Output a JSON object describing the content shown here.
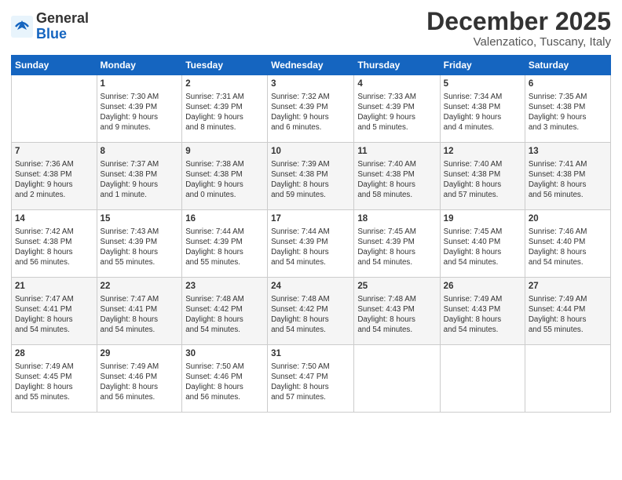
{
  "logo": {
    "general": "General",
    "blue": "Blue"
  },
  "header": {
    "month": "December 2025",
    "location": "Valenzatico, Tuscany, Italy"
  },
  "weekdays": [
    "Sunday",
    "Monday",
    "Tuesday",
    "Wednesday",
    "Thursday",
    "Friday",
    "Saturday"
  ],
  "weeks": [
    [
      {
        "day": null,
        "info": null
      },
      {
        "day": "1",
        "info": "Sunrise: 7:30 AM\nSunset: 4:39 PM\nDaylight: 9 hours\nand 9 minutes."
      },
      {
        "day": "2",
        "info": "Sunrise: 7:31 AM\nSunset: 4:39 PM\nDaylight: 9 hours\nand 8 minutes."
      },
      {
        "day": "3",
        "info": "Sunrise: 7:32 AM\nSunset: 4:39 PM\nDaylight: 9 hours\nand 6 minutes."
      },
      {
        "day": "4",
        "info": "Sunrise: 7:33 AM\nSunset: 4:39 PM\nDaylight: 9 hours\nand 5 minutes."
      },
      {
        "day": "5",
        "info": "Sunrise: 7:34 AM\nSunset: 4:38 PM\nDaylight: 9 hours\nand 4 minutes."
      },
      {
        "day": "6",
        "info": "Sunrise: 7:35 AM\nSunset: 4:38 PM\nDaylight: 9 hours\nand 3 minutes."
      }
    ],
    [
      {
        "day": "7",
        "info": "Sunrise: 7:36 AM\nSunset: 4:38 PM\nDaylight: 9 hours\nand 2 minutes."
      },
      {
        "day": "8",
        "info": "Sunrise: 7:37 AM\nSunset: 4:38 PM\nDaylight: 9 hours\nand 1 minute."
      },
      {
        "day": "9",
        "info": "Sunrise: 7:38 AM\nSunset: 4:38 PM\nDaylight: 9 hours\nand 0 minutes."
      },
      {
        "day": "10",
        "info": "Sunrise: 7:39 AM\nSunset: 4:38 PM\nDaylight: 8 hours\nand 59 minutes."
      },
      {
        "day": "11",
        "info": "Sunrise: 7:40 AM\nSunset: 4:38 PM\nDaylight: 8 hours\nand 58 minutes."
      },
      {
        "day": "12",
        "info": "Sunrise: 7:40 AM\nSunset: 4:38 PM\nDaylight: 8 hours\nand 57 minutes."
      },
      {
        "day": "13",
        "info": "Sunrise: 7:41 AM\nSunset: 4:38 PM\nDaylight: 8 hours\nand 56 minutes."
      }
    ],
    [
      {
        "day": "14",
        "info": "Sunrise: 7:42 AM\nSunset: 4:38 PM\nDaylight: 8 hours\nand 56 minutes."
      },
      {
        "day": "15",
        "info": "Sunrise: 7:43 AM\nSunset: 4:39 PM\nDaylight: 8 hours\nand 55 minutes."
      },
      {
        "day": "16",
        "info": "Sunrise: 7:44 AM\nSunset: 4:39 PM\nDaylight: 8 hours\nand 55 minutes."
      },
      {
        "day": "17",
        "info": "Sunrise: 7:44 AM\nSunset: 4:39 PM\nDaylight: 8 hours\nand 54 minutes."
      },
      {
        "day": "18",
        "info": "Sunrise: 7:45 AM\nSunset: 4:39 PM\nDaylight: 8 hours\nand 54 minutes."
      },
      {
        "day": "19",
        "info": "Sunrise: 7:45 AM\nSunset: 4:40 PM\nDaylight: 8 hours\nand 54 minutes."
      },
      {
        "day": "20",
        "info": "Sunrise: 7:46 AM\nSunset: 4:40 PM\nDaylight: 8 hours\nand 54 minutes."
      }
    ],
    [
      {
        "day": "21",
        "info": "Sunrise: 7:47 AM\nSunset: 4:41 PM\nDaylight: 8 hours\nand 54 minutes."
      },
      {
        "day": "22",
        "info": "Sunrise: 7:47 AM\nSunset: 4:41 PM\nDaylight: 8 hours\nand 54 minutes."
      },
      {
        "day": "23",
        "info": "Sunrise: 7:48 AM\nSunset: 4:42 PM\nDaylight: 8 hours\nand 54 minutes."
      },
      {
        "day": "24",
        "info": "Sunrise: 7:48 AM\nSunset: 4:42 PM\nDaylight: 8 hours\nand 54 minutes."
      },
      {
        "day": "25",
        "info": "Sunrise: 7:48 AM\nSunset: 4:43 PM\nDaylight: 8 hours\nand 54 minutes."
      },
      {
        "day": "26",
        "info": "Sunrise: 7:49 AM\nSunset: 4:43 PM\nDaylight: 8 hours\nand 54 minutes."
      },
      {
        "day": "27",
        "info": "Sunrise: 7:49 AM\nSunset: 4:44 PM\nDaylight: 8 hours\nand 55 minutes."
      }
    ],
    [
      {
        "day": "28",
        "info": "Sunrise: 7:49 AM\nSunset: 4:45 PM\nDaylight: 8 hours\nand 55 minutes."
      },
      {
        "day": "29",
        "info": "Sunrise: 7:49 AM\nSunset: 4:46 PM\nDaylight: 8 hours\nand 56 minutes."
      },
      {
        "day": "30",
        "info": "Sunrise: 7:50 AM\nSunset: 4:46 PM\nDaylight: 8 hours\nand 56 minutes."
      },
      {
        "day": "31",
        "info": "Sunrise: 7:50 AM\nSunset: 4:47 PM\nDaylight: 8 hours\nand 57 minutes."
      },
      {
        "day": null,
        "info": null
      },
      {
        "day": null,
        "info": null
      },
      {
        "day": null,
        "info": null
      }
    ]
  ]
}
